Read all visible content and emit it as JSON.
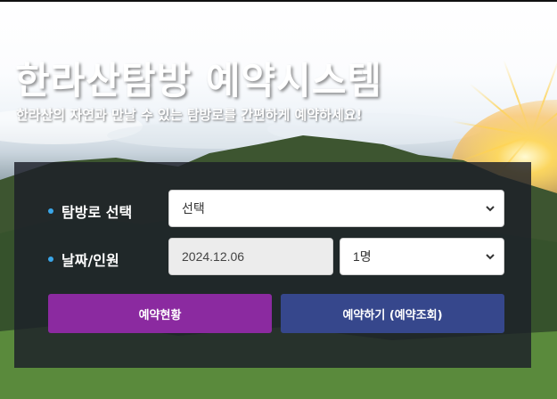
{
  "header": {
    "title": "한라산탐방 예약시스템",
    "subtitle": "한라산의 자연과 만날 수 있는 탐방로를 간편하게 예약하세요!"
  },
  "form": {
    "trail_label": "탐방로 선택",
    "trail_value": "선택",
    "date_label": "날짜/인원",
    "date_value": "2024.12.06",
    "people_value": "1명"
  },
  "buttons": {
    "status_label": "예약현황",
    "book_label": "예약하기 (예약조회)"
  },
  "colors": {
    "status_button": "#8b2aa0",
    "book_button": "#36478c",
    "bullet": "#3aa6e8"
  }
}
